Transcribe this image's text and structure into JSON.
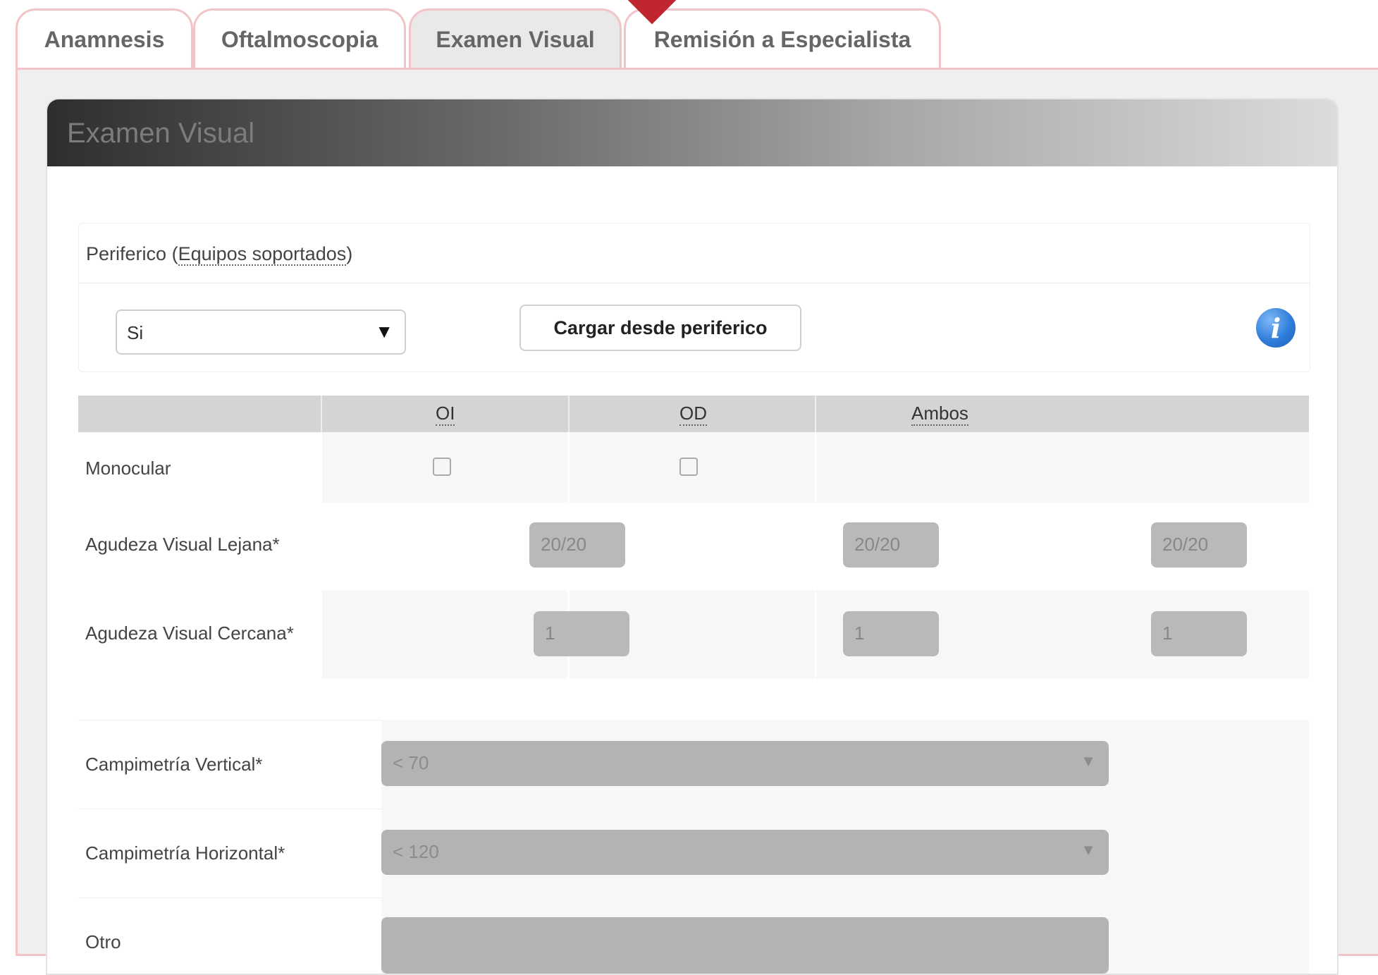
{
  "tabs": [
    {
      "label": "Anamnesis",
      "active": false
    },
    {
      "label": "Oftalmoscopia",
      "active": false
    },
    {
      "label": "Examen Visual",
      "active": true
    },
    {
      "label": "Remisión a Especialista",
      "active": false
    }
  ],
  "panel": {
    "title": "Examen Visual"
  },
  "periferico": {
    "label": "Periferico",
    "paren_open": "(",
    "link": "Equipos soportados",
    "paren_close": ")",
    "select_value": "Si",
    "arrow": "▼",
    "load_button": "Cargar desde periferico",
    "info_glyph": "i"
  },
  "grid": {
    "columns": [
      "OI",
      "OD",
      "Ambos"
    ],
    "rows": {
      "monocular": {
        "label": "Monocular",
        "oi_checked": false,
        "od_checked": false
      },
      "lejana": {
        "label": "Agudeza Visual Lejana*",
        "oi": "20/20",
        "od": "20/20",
        "ambos": "20/20"
      },
      "cercana": {
        "label": "Agudeza Visual Cercana*",
        "oi": "1",
        "od": "1",
        "ambos": "1"
      }
    }
  },
  "campimetria": {
    "vertical": {
      "label": "Campimetría Vertical*",
      "value": "< 70",
      "arrow": "▼"
    },
    "horizontal": {
      "label": "Campimetría Horizontal*",
      "value": "< 120",
      "arrow": "▼"
    },
    "otro": {
      "label": "Otro",
      "value": ""
    }
  },
  "colors": {
    "accent_red": "#c0262f",
    "tab_border": "#f2c4c8",
    "info_blue": "#2f7ddb"
  }
}
